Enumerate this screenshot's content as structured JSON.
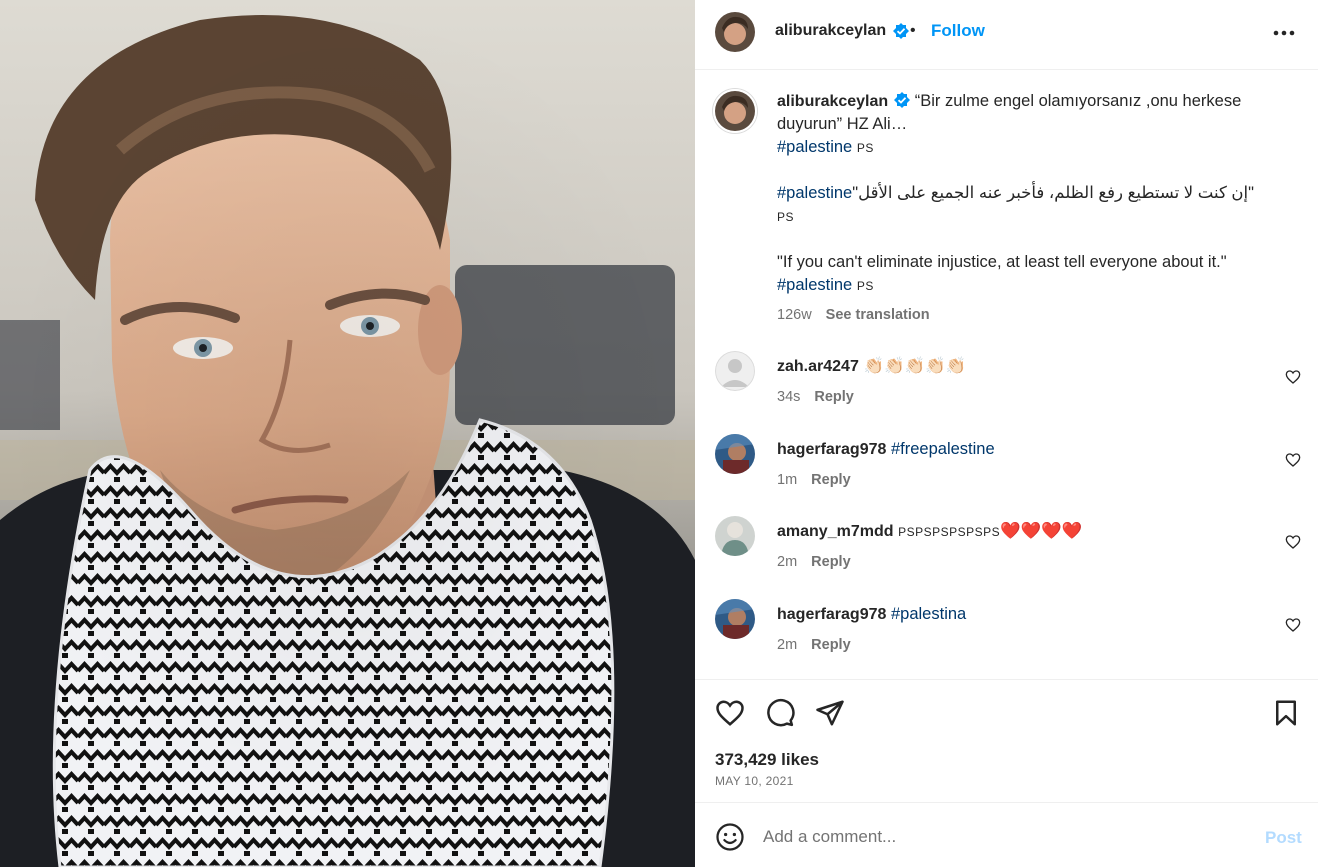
{
  "post": {
    "author": "aliburakceylan",
    "follow_label": "Follow",
    "separator": "•",
    "more_icon": "more-options-icon",
    "photo_alt": "Portrait of a man wearing a black and white keffiyeh scarf"
  },
  "caption": {
    "author": "aliburakceylan",
    "line1": "“Bir zulme engel olamıyorsanız ,onu herkese duyurun” HZ Ali…",
    "hashtag1": "#palestine",
    "ps1": "PS",
    "arabic_text": "\"إن كنت لا تستطيع رفع الظلم، فأخبر عنه الجميع على الأقل\"",
    "hashtag2": "#palestine",
    "ps2": "PS",
    "english_text": "\"If you can't eliminate injustice, at least tell everyone about it.\"",
    "hashtag3": "#palestine",
    "ps3": "PS",
    "age": "126w",
    "see_translation": "See translation"
  },
  "comments": [
    {
      "user": "zah.ar4247",
      "text": "👏🏻👏🏻👏🏻👏🏻👏🏻",
      "hashtag": "",
      "age": "34s",
      "reply": "Reply"
    },
    {
      "user": "hagerfarag978",
      "text": "",
      "hashtag": "#freepalestine",
      "age": "1m",
      "reply": "Reply"
    },
    {
      "user": "amany_m7mdd",
      "text": "PSPSPSPSPSPS",
      "hearts": "❤️❤️❤️❤️",
      "hashtag": "",
      "age": "2m",
      "reply": "Reply"
    },
    {
      "user": "hagerfarag978",
      "text": "",
      "hashtag": "#palestina",
      "age": "2m",
      "reply": "Reply"
    }
  ],
  "actions": {
    "likes": "373,429 likes",
    "date": "MAY 10, 2021"
  },
  "add_comment": {
    "placeholder": "Add a comment...",
    "post_label": "Post"
  },
  "colors": {
    "link_blue": "#0095f6",
    "hashtag_navy": "#00376b",
    "muted_gray": "#737373",
    "post_disabled": "#b3dbff"
  }
}
